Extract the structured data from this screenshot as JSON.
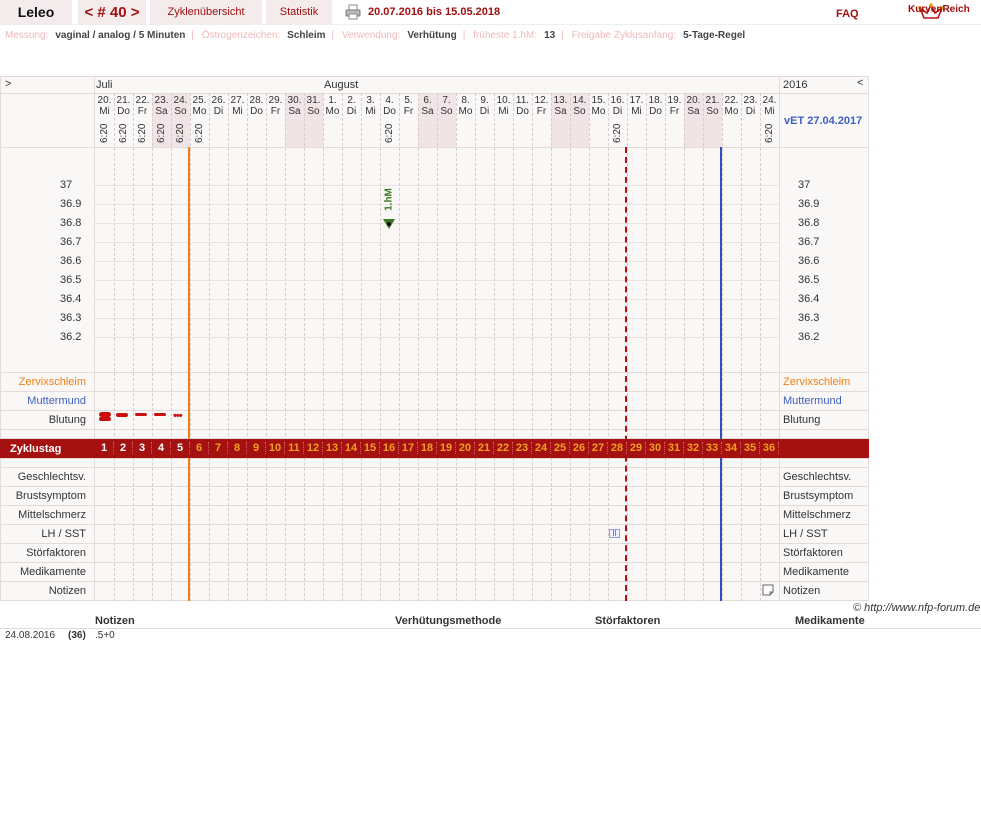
{
  "header": {
    "user_name": "Leleo",
    "cycle_nav": "< # 40 >",
    "tab_overview": "Zyklenübersicht",
    "tab_statistics": "Statistik",
    "date_range": "20.07.2016 bis 15.05.2018",
    "faq": "FAQ",
    "logo_text": "KurvenReich"
  },
  "info": {
    "measure_label": "Messung:",
    "measure_value": "vaginal / analog / 5 Minuten",
    "estrogen_label": "Östrogenzeichen:",
    "estrogen_value": "Schleim",
    "usage_label": "Verwendung:",
    "usage_value": "Verhütung",
    "earliest_label": "früheste 1.hM:",
    "earliest_value": "13",
    "release_label": "Freigabe Zyklusanfang:",
    "release_value": "5-Tage-Regel"
  },
  "grid": {
    "nav_left": ">",
    "nav_right": "<",
    "month_july": "Juli",
    "month_august": "August",
    "year": "2016",
    "vet": "vET 27.04.2017",
    "days": [
      {
        "d": "20.",
        "w": "Mi",
        "t": "6:20",
        "we": false
      },
      {
        "d": "21.",
        "w": "Do",
        "t": "6:20",
        "we": false
      },
      {
        "d": "22.",
        "w": "Fr",
        "t": "6:20",
        "we": false
      },
      {
        "d": "23.",
        "w": "Sa",
        "t": "6:20",
        "we": true
      },
      {
        "d": "24.",
        "w": "So",
        "t": "6:20",
        "we": true
      },
      {
        "d": "25.",
        "w": "Mo",
        "t": "6:20",
        "we": false
      },
      {
        "d": "26.",
        "w": "Di",
        "t": "",
        "we": false
      },
      {
        "d": "27.",
        "w": "Mi",
        "t": "",
        "we": false
      },
      {
        "d": "28.",
        "w": "Do",
        "t": "",
        "we": false
      },
      {
        "d": "29.",
        "w": "Fr",
        "t": "",
        "we": false
      },
      {
        "d": "30.",
        "w": "Sa",
        "t": "",
        "we": true
      },
      {
        "d": "31.",
        "w": "So",
        "t": "",
        "we": true
      },
      {
        "d": "1.",
        "w": "Mo",
        "t": "",
        "we": false
      },
      {
        "d": "2.",
        "w": "Di",
        "t": "",
        "we": false
      },
      {
        "d": "3.",
        "w": "Mi",
        "t": "",
        "we": false
      },
      {
        "d": "4.",
        "w": "Do",
        "t": "6:20",
        "we": false
      },
      {
        "d": "5.",
        "w": "Fr",
        "t": "",
        "we": false
      },
      {
        "d": "6.",
        "w": "Sa",
        "t": "",
        "we": true
      },
      {
        "d": "7.",
        "w": "So",
        "t": "",
        "we": true
      },
      {
        "d": "8.",
        "w": "Mo",
        "t": "",
        "we": false
      },
      {
        "d": "9.",
        "w": "Di",
        "t": "",
        "we": false
      },
      {
        "d": "10.",
        "w": "Mi",
        "t": "",
        "we": false
      },
      {
        "d": "11.",
        "w": "Do",
        "t": "",
        "we": false
      },
      {
        "d": "12.",
        "w": "Fr",
        "t": "",
        "we": false
      },
      {
        "d": "13.",
        "w": "Sa",
        "t": "",
        "we": true
      },
      {
        "d": "14.",
        "w": "So",
        "t": "",
        "we": true
      },
      {
        "d": "15.",
        "w": "Mo",
        "t": "",
        "we": false
      },
      {
        "d": "16.",
        "w": "Di",
        "t": "6:20",
        "we": false
      },
      {
        "d": "17.",
        "w": "Mi",
        "t": "",
        "we": false
      },
      {
        "d": "18.",
        "w": "Do",
        "t": "",
        "we": false
      },
      {
        "d": "19.",
        "w": "Fr",
        "t": "",
        "we": false
      },
      {
        "d": "20.",
        "w": "Sa",
        "t": "",
        "we": true
      },
      {
        "d": "21.",
        "w": "So",
        "t": "",
        "we": true
      },
      {
        "d": "22.",
        "w": "Mo",
        "t": "",
        "we": false
      },
      {
        "d": "23.",
        "w": "Di",
        "t": "",
        "we": false
      },
      {
        "d": "24.",
        "w": "Mi",
        "t": "6:20",
        "we": false
      }
    ],
    "temps": [
      "37",
      "36.9",
      "36.8",
      "36.7",
      "36.6",
      "36.5",
      "36.4",
      "36.3",
      "36.2"
    ],
    "hm_label": "1.hM",
    "rows": {
      "zervix": "Zervixschleim",
      "muttermund": "Muttermund",
      "blutung": "Blutung",
      "zyklustag": "Zyklustag",
      "gv": "Geschlechtsv.",
      "brust": "Brustsymptom",
      "mittel": "Mittelschmerz",
      "lh": "LH / SST",
      "stoer": "Störfaktoren",
      "medi": "Medikamente",
      "notizen": "Notizen"
    },
    "cycle_days": [
      "1",
      "2",
      "3",
      "4",
      "5",
      "6",
      "7",
      "8",
      "9",
      "10",
      "11",
      "12",
      "13",
      "14",
      "15",
      "16",
      "17",
      "18",
      "19",
      "20",
      "21",
      "22",
      "23",
      "24",
      "25",
      "26",
      "27",
      "28",
      "29",
      "30",
      "31",
      "32",
      "33",
      "34",
      "35",
      "36"
    ]
  },
  "footer": {
    "copyright": "© http://www.nfp-forum.de",
    "col_notes": "Notizen",
    "col_method": "Verhütungsmethode",
    "col_disturb": "Störfaktoren",
    "col_meds": "Medikamente",
    "entry_date": "24.08.2016",
    "entry_day": "(36)",
    "entry_note": ".5+0"
  },
  "colors": {
    "brand": "#a01010",
    "zyklus_bar": "#a51010",
    "cycle_start_line": "#f08010",
    "ovulation_line": "#b01010",
    "period_end_line": "#3050c0",
    "hm_marker": "#3a7a20"
  }
}
